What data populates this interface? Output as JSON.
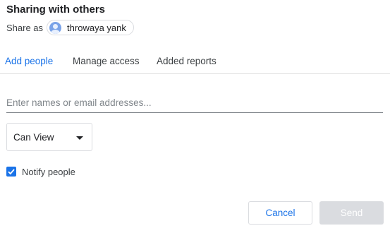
{
  "dialog": {
    "title": "Sharing with others"
  },
  "share_as": {
    "label": "Share as",
    "user_name": "throwaya yank"
  },
  "tabs": [
    {
      "label": "Add people",
      "active": true
    },
    {
      "label": "Manage access",
      "active": false
    },
    {
      "label": "Added reports",
      "active": false
    }
  ],
  "recipients": {
    "placeholder": "Enter names or email addresses...",
    "value": ""
  },
  "permission": {
    "selected": "Can View"
  },
  "notify": {
    "label": "Notify people",
    "checked": true
  },
  "buttons": {
    "cancel_label": "Cancel",
    "send_label": "Send",
    "send_enabled": false
  },
  "colors": {
    "accent": "#1a73e8",
    "disabled_button": "#dadce0",
    "border": "#dadce0"
  }
}
